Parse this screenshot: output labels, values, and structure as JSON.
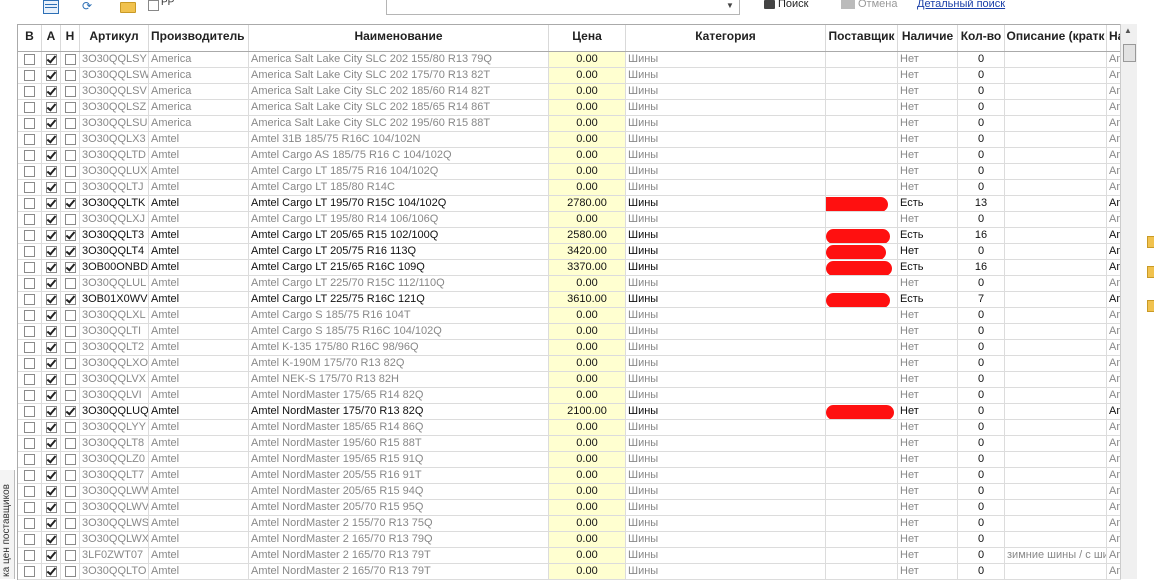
{
  "toolbar": {
    "pp_label": "PP",
    "search_label": "Поиск",
    "cancel_label": "Отмена",
    "detail_link": "Детальный поиск",
    "search_value": ""
  },
  "side_tab_label": "ка цен поставщиков",
  "columns": [
    {
      "label": "В"
    },
    {
      "label": "А"
    },
    {
      "label": "Н"
    },
    {
      "label": "Артикул"
    },
    {
      "label": "Производитель"
    },
    {
      "label": "Наименование"
    },
    {
      "label": "Цена"
    },
    {
      "label": "Категория"
    },
    {
      "label": "Поставщик"
    },
    {
      "label": "Наличие"
    },
    {
      "label": "Кол-во"
    },
    {
      "label": "Описание (кратк"
    },
    {
      "label": "На"
    }
  ],
  "rows": [
    {
      "v": false,
      "a": true,
      "n": false,
      "article": "3O30QQLSY",
      "maker": "America",
      "name": "America Salt Lake City SLC 202 155/80 R13 79Q",
      "price": "0.00",
      "category": "Шины",
      "supplier": "",
      "stock": "Нет",
      "qty": "0",
      "desc": "",
      "extra": "Am",
      "active": false
    },
    {
      "v": false,
      "a": true,
      "n": false,
      "article": "3O30QQLSW",
      "maker": "America",
      "name": "America Salt Lake City SLC 202 175/70 R13 82T",
      "price": "0.00",
      "category": "Шины",
      "supplier": "",
      "stock": "Нет",
      "qty": "0",
      "desc": "",
      "extra": "Am",
      "active": false
    },
    {
      "v": false,
      "a": true,
      "n": false,
      "article": "3O30QQLSV",
      "maker": "America",
      "name": "America Salt Lake City SLC 202 185/60 R14 82T",
      "price": "0.00",
      "category": "Шины",
      "supplier": "",
      "stock": "Нет",
      "qty": "0",
      "desc": "",
      "extra": "Am",
      "active": false
    },
    {
      "v": false,
      "a": true,
      "n": false,
      "article": "3O30QQLSZ",
      "maker": "America",
      "name": "America Salt Lake City SLC 202 185/65 R14 86T",
      "price": "0.00",
      "category": "Шины",
      "supplier": "",
      "stock": "Нет",
      "qty": "0",
      "desc": "",
      "extra": "Am",
      "active": false
    },
    {
      "v": false,
      "a": true,
      "n": false,
      "article": "3O30QQLSU",
      "maker": "America",
      "name": "America Salt Lake City SLC 202 195/60 R15 88T",
      "price": "0.00",
      "category": "Шины",
      "supplier": "",
      "stock": "Нет",
      "qty": "0",
      "desc": "",
      "extra": "Am",
      "active": false
    },
    {
      "v": false,
      "a": true,
      "n": false,
      "article": "3O30QQLX3",
      "maker": "Amtel",
      "name": "Amtel 31B 185/75 R16C 104/102N",
      "price": "0.00",
      "category": "Шины",
      "supplier": "",
      "stock": "Нет",
      "qty": "0",
      "desc": "",
      "extra": "Am",
      "active": false
    },
    {
      "v": false,
      "a": true,
      "n": false,
      "article": "3O30QQLTD",
      "maker": "Amtel",
      "name": "Amtel Cargo AS 185/75 R16 C 104/102Q",
      "price": "0.00",
      "category": "Шины",
      "supplier": "",
      "stock": "Нет",
      "qty": "0",
      "desc": "",
      "extra": "Am",
      "active": false
    },
    {
      "v": false,
      "a": true,
      "n": false,
      "article": "3O30QQLUX",
      "maker": "Amtel",
      "name": "Amtel Cargo LT 185/75 R16 104/102Q",
      "price": "0.00",
      "category": "Шины",
      "supplier": "",
      "stock": "Нет",
      "qty": "0",
      "desc": "",
      "extra": "Am",
      "active": false
    },
    {
      "v": false,
      "a": true,
      "n": false,
      "article": "3O30QQLTJ",
      "maker": "Amtel",
      "name": "Amtel Cargo LT 185/80 R14C",
      "price": "0.00",
      "category": "Шины",
      "supplier": "",
      "stock": "Нет",
      "qty": "0",
      "desc": "",
      "extra": "Am",
      "active": false
    },
    {
      "v": false,
      "a": true,
      "n": true,
      "article": "3O30QQLTK",
      "maker": "Amtel",
      "name": "Amtel Cargo LT 195/70 R15C 104/102Q",
      "price": "2780.00",
      "category": "Шины",
      "supplier": "redacted",
      "stock": "Есть",
      "qty": "13",
      "desc": "",
      "extra": "Am",
      "active": true
    },
    {
      "v": false,
      "a": true,
      "n": false,
      "article": "3O30QQLXJ",
      "maker": "Amtel",
      "name": "Amtel Cargo LT 195/80 R14 106/106Q",
      "price": "0.00",
      "category": "Шины",
      "supplier": "",
      "stock": "Нет",
      "qty": "0",
      "desc": "",
      "extra": "Am",
      "active": false
    },
    {
      "v": false,
      "a": true,
      "n": true,
      "article": "3O30QQLT3",
      "maker": "Amtel",
      "name": "Amtel Cargo LT 205/65 R15 102/100Q",
      "price": "2580.00",
      "category": "Шины",
      "supplier": "redacted",
      "stock": "Есть",
      "qty": "16",
      "desc": "",
      "extra": "Am",
      "active": true
    },
    {
      "v": false,
      "a": true,
      "n": true,
      "article": "3O30QQLT4",
      "maker": "Amtel",
      "name": "Amtel Cargo LT 205/75 R16 113Q",
      "price": "3420.00",
      "category": "Шины",
      "supplier": "redacted",
      "stock": "Нет",
      "qty": "0",
      "desc": "",
      "extra": "Am",
      "active": true
    },
    {
      "v": false,
      "a": true,
      "n": true,
      "article": "3OB00ONBD",
      "maker": "Amtel",
      "name": "Amtel Cargo LT 215/65 R16C 109Q",
      "price": "3370.00",
      "category": "Шины",
      "supplier": "redacted",
      "stock": "Есть",
      "qty": "16",
      "desc": "",
      "extra": "Am",
      "active": true
    },
    {
      "v": false,
      "a": true,
      "n": false,
      "article": "3O30QQLUL",
      "maker": "Amtel",
      "name": "Amtel Cargo LT 225/70 R15C 112/110Q",
      "price": "0.00",
      "category": "Шины",
      "supplier": "",
      "stock": "Нет",
      "qty": "0",
      "desc": "",
      "extra": "Am",
      "active": false
    },
    {
      "v": false,
      "a": true,
      "n": true,
      "article": "3OB01X0WV",
      "maker": "Amtel",
      "name": "Amtel Cargo LT 225/75 R16C 121Q",
      "price": "3610.00",
      "category": "Шины",
      "supplier": "redacted",
      "stock": "Есть",
      "qty": "7",
      "desc": "",
      "extra": "Am",
      "active": true
    },
    {
      "v": false,
      "a": true,
      "n": false,
      "article": "3O30QQLXL",
      "maker": "Amtel",
      "name": "Amtel Cargo S 185/75 R16 104T",
      "price": "0.00",
      "category": "Шины",
      "supplier": "",
      "stock": "Нет",
      "qty": "0",
      "desc": "",
      "extra": "Am",
      "active": false
    },
    {
      "v": false,
      "a": true,
      "n": false,
      "article": "3O30QQLTI",
      "maker": "Amtel",
      "name": "Amtel Cargo S 185/75 R16C 104/102Q",
      "price": "0.00",
      "category": "Шины",
      "supplier": "",
      "stock": "Нет",
      "qty": "0",
      "desc": "",
      "extra": "Am",
      "active": false
    },
    {
      "v": false,
      "a": true,
      "n": false,
      "article": "3O30QQLT2",
      "maker": "Amtel",
      "name": "Amtel K-135 175/80 R16C 98/96Q",
      "price": "0.00",
      "category": "Шины",
      "supplier": "",
      "stock": "Нет",
      "qty": "0",
      "desc": "",
      "extra": "Am",
      "active": false
    },
    {
      "v": false,
      "a": true,
      "n": false,
      "article": "3O30QQLXO",
      "maker": "Amtel",
      "name": "Amtel K-190M 175/70 R13 82Q",
      "price": "0.00",
      "category": "Шины",
      "supplier": "",
      "stock": "Нет",
      "qty": "0",
      "desc": "",
      "extra": "Am",
      "active": false
    },
    {
      "v": false,
      "a": true,
      "n": false,
      "article": "3O30QQLVX",
      "maker": "Amtel",
      "name": "Amtel NEK-S 175/70 R13 82H",
      "price": "0.00",
      "category": "Шины",
      "supplier": "",
      "stock": "Нет",
      "qty": "0",
      "desc": "",
      "extra": "Am",
      "active": false
    },
    {
      "v": false,
      "a": true,
      "n": false,
      "article": "3O30QQLVI",
      "maker": "Amtel",
      "name": "Amtel NordMaster 175/65 R14 82Q",
      "price": "0.00",
      "category": "Шины",
      "supplier": "",
      "stock": "Нет",
      "qty": "0",
      "desc": "",
      "extra": "Am",
      "active": false
    },
    {
      "v": false,
      "a": true,
      "n": true,
      "article": "3O30QQLUQ",
      "maker": "Amtel",
      "name": "Amtel NordMaster 175/70 R13 82Q",
      "price": "2100.00",
      "category": "Шины",
      "supplier": "redacted",
      "stock": "Нет",
      "qty": "0",
      "desc": "",
      "extra": "Am",
      "active": true
    },
    {
      "v": false,
      "a": true,
      "n": false,
      "article": "3O30QQLYY",
      "maker": "Amtel",
      "name": "Amtel NordMaster 185/65 R14 86Q",
      "price": "0.00",
      "category": "Шины",
      "supplier": "",
      "stock": "Нет",
      "qty": "0",
      "desc": "",
      "extra": "Am",
      "active": false
    },
    {
      "v": false,
      "a": true,
      "n": false,
      "article": "3O30QQLT8",
      "maker": "Amtel",
      "name": "Amtel NordMaster 195/60 R15 88T",
      "price": "0.00",
      "category": "Шины",
      "supplier": "",
      "stock": "Нет",
      "qty": "0",
      "desc": "",
      "extra": "Am",
      "active": false
    },
    {
      "v": false,
      "a": true,
      "n": false,
      "article": "3O30QQLZ0",
      "maker": "Amtel",
      "name": "Amtel NordMaster 195/65 R15 91Q",
      "price": "0.00",
      "category": "Шины",
      "supplier": "",
      "stock": "Нет",
      "qty": "0",
      "desc": "",
      "extra": "Am",
      "active": false
    },
    {
      "v": false,
      "a": true,
      "n": false,
      "article": "3O30QQLT7",
      "maker": "Amtel",
      "name": "Amtel NordMaster 205/55 R16 91T",
      "price": "0.00",
      "category": "Шины",
      "supplier": "",
      "stock": "Нет",
      "qty": "0",
      "desc": "",
      "extra": "Am",
      "active": false
    },
    {
      "v": false,
      "a": true,
      "n": false,
      "article": "3O30QQLWW",
      "maker": "Amtel",
      "name": "Amtel NordMaster 205/65 R15 94Q",
      "price": "0.00",
      "category": "Шины",
      "supplier": "",
      "stock": "Нет",
      "qty": "0",
      "desc": "",
      "extra": "Am",
      "active": false
    },
    {
      "v": false,
      "a": true,
      "n": false,
      "article": "3O30QQLWV",
      "maker": "Amtel",
      "name": "Amtel NordMaster 205/70 R15 95Q",
      "price": "0.00",
      "category": "Шины",
      "supplier": "",
      "stock": "Нет",
      "qty": "0",
      "desc": "",
      "extra": "Am",
      "active": false
    },
    {
      "v": false,
      "a": true,
      "n": false,
      "article": "3O30QQLWS",
      "maker": "Amtel",
      "name": "Amtel NordMaster 2 155/70 R13 75Q",
      "price": "0.00",
      "category": "Шины",
      "supplier": "",
      "stock": "Нет",
      "qty": "0",
      "desc": "",
      "extra": "Am",
      "active": false
    },
    {
      "v": false,
      "a": true,
      "n": false,
      "article": "3O30QQLWX",
      "maker": "Amtel",
      "name": "Amtel NordMaster 2 165/70 R13 79Q",
      "price": "0.00",
      "category": "Шины",
      "supplier": "",
      "stock": "Нет",
      "qty": "0",
      "desc": "",
      "extra": "Am",
      "active": false
    },
    {
      "v": false,
      "a": true,
      "n": false,
      "article": "3LF0ZWT07",
      "maker": "Amtel",
      "name": "Amtel NordMaster 2 165/70 R13 79T",
      "price": "0.00",
      "category": "Шины",
      "supplier": "",
      "stock": "Нет",
      "qty": "0",
      "desc": "зимние шины / с ши",
      "extra": "Am",
      "active": false
    },
    {
      "v": false,
      "a": true,
      "n": false,
      "article": "3O30QQLTO",
      "maker": "Amtel",
      "name": "Amtel NordMaster 2 165/70 R13 79T",
      "price": "0.00",
      "category": "Шины",
      "supplier": "",
      "stock": "Нет",
      "qty": "0",
      "desc": "",
      "extra": "Am",
      "active": false
    }
  ],
  "colors": {
    "price_bg": "#ffffd0",
    "redaction": "#ff1010",
    "link": "#1a3fa8"
  }
}
